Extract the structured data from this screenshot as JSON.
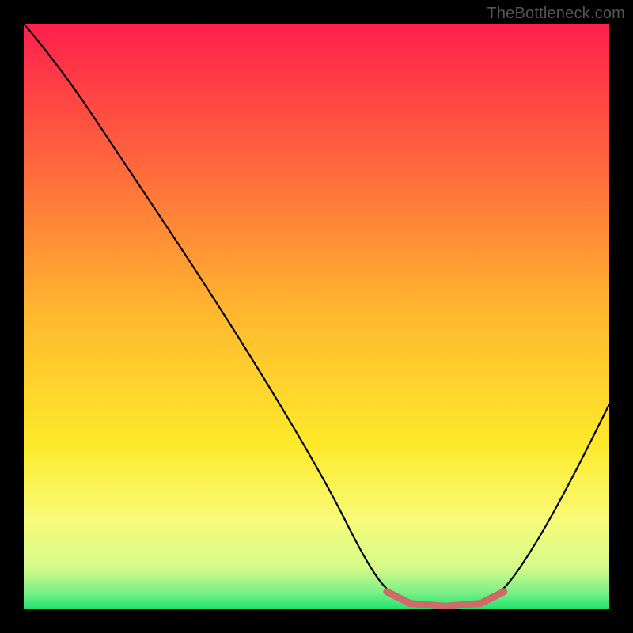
{
  "watermark": "TheBottleneck.com",
  "chart_data": {
    "type": "line",
    "title": "",
    "xlabel": "",
    "ylabel": "",
    "xlim": [
      0,
      100
    ],
    "ylim": [
      0,
      100
    ],
    "grid": false,
    "legend": false,
    "series": [
      {
        "name": "bottleneck-curve",
        "color": "#000000",
        "points": [
          {
            "x": 0,
            "y": 100
          },
          {
            "x": 6,
            "y": 93
          },
          {
            "x": 18,
            "y": 75
          },
          {
            "x": 30,
            "y": 57
          },
          {
            "x": 42,
            "y": 38
          },
          {
            "x": 52,
            "y": 21
          },
          {
            "x": 58,
            "y": 9
          },
          {
            "x": 62,
            "y": 3
          },
          {
            "x": 66,
            "y": 1
          },
          {
            "x": 72,
            "y": 0.5
          },
          {
            "x": 78,
            "y": 1
          },
          {
            "x": 82,
            "y": 3
          },
          {
            "x": 88,
            "y": 12
          },
          {
            "x": 94,
            "y": 23
          },
          {
            "x": 100,
            "y": 35
          }
        ]
      },
      {
        "name": "optimal-range-marker",
        "color": "#cf6a6a",
        "points": [
          {
            "x": 62,
            "y": 3
          },
          {
            "x": 66,
            "y": 1
          },
          {
            "x": 72,
            "y": 0.5
          },
          {
            "x": 78,
            "y": 1
          },
          {
            "x": 82,
            "y": 3
          }
        ]
      }
    ],
    "background_gradient": {
      "type": "vertical",
      "stops": [
        {
          "pos": 0.0,
          "color": "#ff1f4b"
        },
        {
          "pos": 0.25,
          "color": "#ff6a3c"
        },
        {
          "pos": 0.5,
          "color": "#ffb92e"
        },
        {
          "pos": 0.72,
          "color": "#fdea2a"
        },
        {
          "pos": 0.85,
          "color": "#f8fb7a"
        },
        {
          "pos": 0.93,
          "color": "#d3fb8a"
        },
        {
          "pos": 0.97,
          "color": "#7ef087"
        },
        {
          "pos": 1.0,
          "color": "#1ee36e"
        }
      ]
    }
  }
}
